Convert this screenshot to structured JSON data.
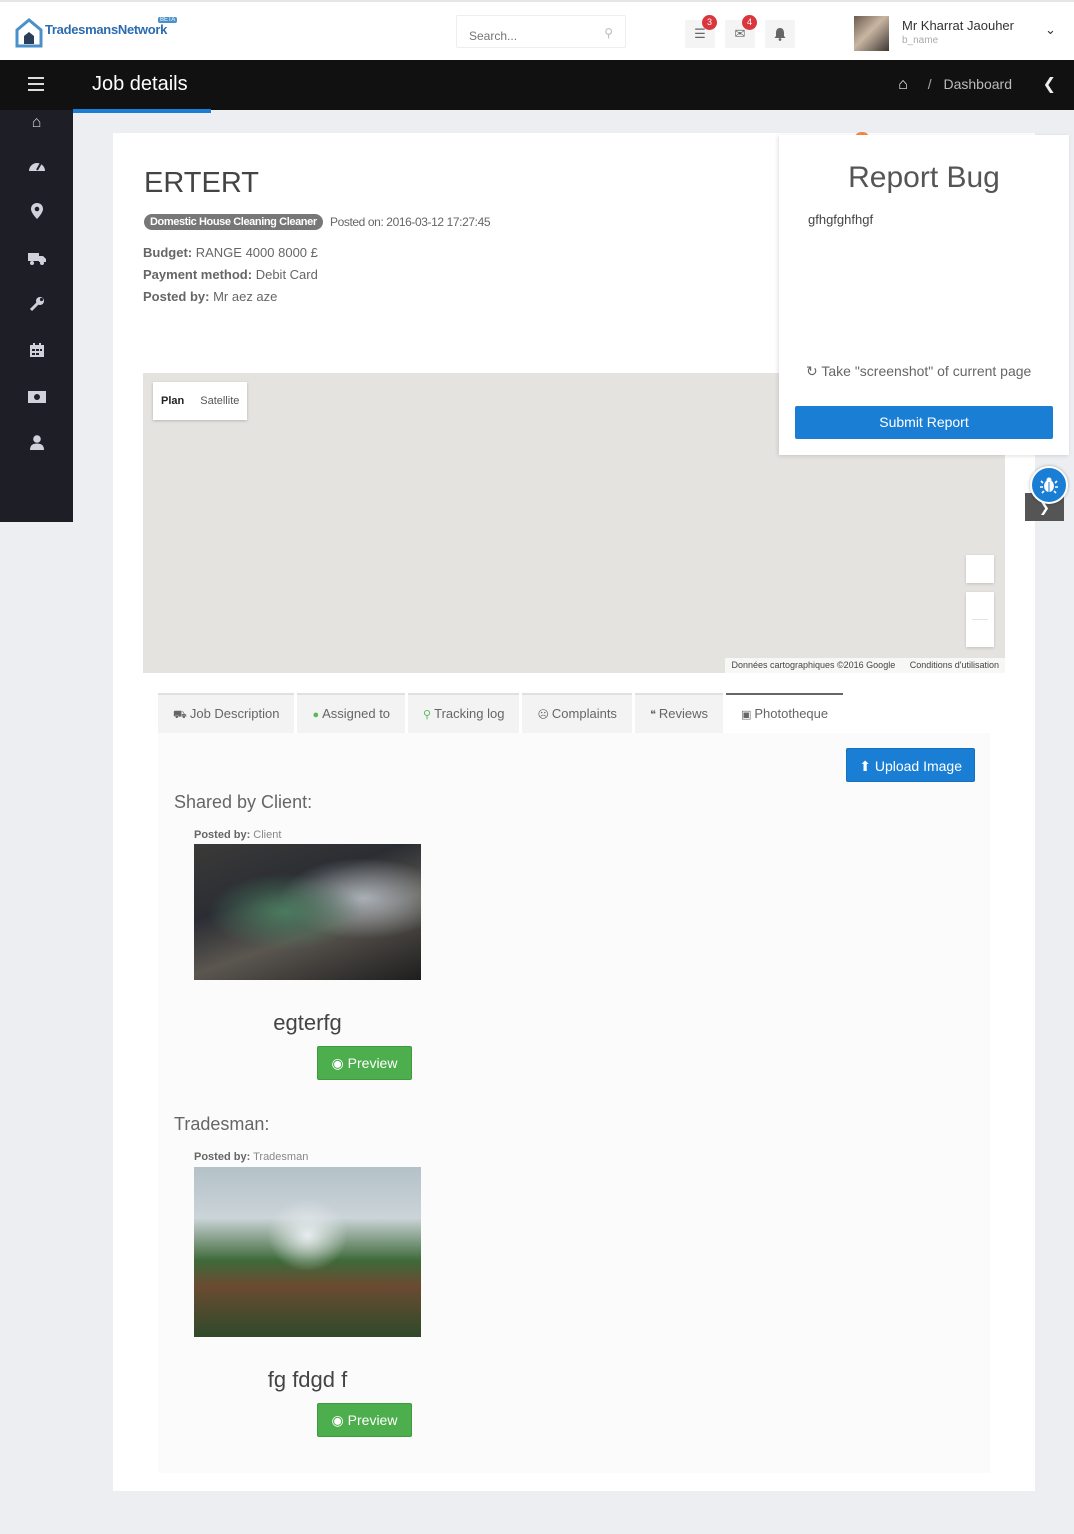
{
  "brand": {
    "name": "TradesmansNetwork",
    "tag": "BETA"
  },
  "search": {
    "placeholder": "Search..."
  },
  "notifications": {
    "tasks_count": "3",
    "messages_count": "4"
  },
  "user": {
    "name": "Mr Kharrat Jaouher",
    "subtitle": "b_name"
  },
  "header": {
    "title": "Job details"
  },
  "breadcrumb": {
    "current": "Dashboard",
    "separator": "/"
  },
  "sidebar": {
    "icons": [
      "home-icon",
      "dashboard-icon",
      "map-marker-icon",
      "truck-icon",
      "wrench-icon",
      "calendar-icon",
      "money-icon",
      "user-icon"
    ]
  },
  "job": {
    "title": "ERTERT",
    "category": "Domestic House Cleaning Cleaner",
    "posted_on": "Posted on: 2016-03-12 17:27:45",
    "budget_label": "Budget:",
    "budget_value": "RANGE 4000 8000 £",
    "payment_label": "Payment method:",
    "payment_value": "Debit Card",
    "posted_by_label": "Posted by:",
    "posted_by_value": "Mr aez aze"
  },
  "map": {
    "type_plan": "Plan",
    "type_satellite": "Satellite",
    "attribution": "Données cartographiques ©2016 Google",
    "terms": "Conditions d'utilisation"
  },
  "tabs": [
    {
      "label": "Job Description",
      "icon": "truck-icon"
    },
    {
      "label": "Assigned to",
      "icon": "user-icon"
    },
    {
      "label": "Tracking log",
      "icon": "map-marker-icon"
    },
    {
      "label": "Complaints",
      "icon": "frown-icon"
    },
    {
      "label": "Reviews",
      "icon": "comments-icon"
    },
    {
      "label": "Phototheque",
      "icon": "image-icon"
    }
  ],
  "phototheque": {
    "upload_label": "Upload Image",
    "client_heading": "Shared by Client:",
    "client_posted_label": "Posted by:",
    "client_posted_value": "Client",
    "client_caption": "egterfg",
    "tradesman_heading": "Tradesman:",
    "tradesman_posted_label": "Posted by:",
    "tradesman_posted_value": "Tradesman",
    "tradesman_caption": "fg fdgd f",
    "preview_label": "Preview"
  },
  "report_bug": {
    "title": "Report Bug",
    "text": "gfhgfghfhgf",
    "screenshot_label": "Take \"screenshot\" of current page",
    "submit_label": "Submit Report"
  }
}
